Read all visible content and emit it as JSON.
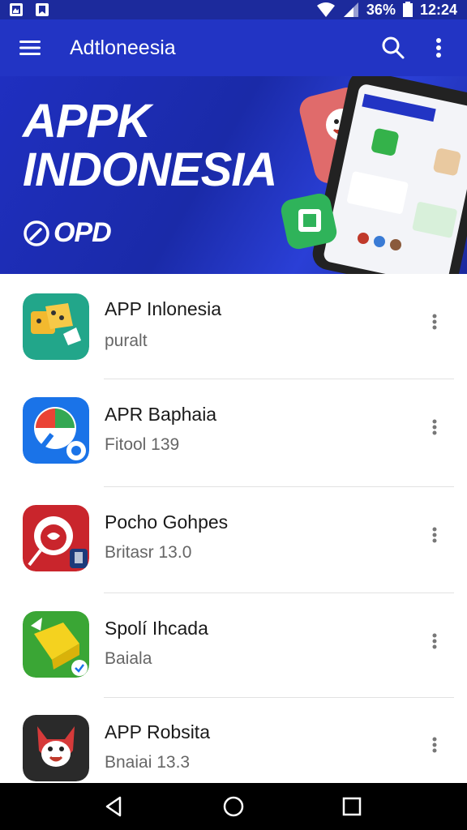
{
  "status_bar": {
    "battery": "36%",
    "time": "12:24"
  },
  "app_bar": {
    "title": "Adtloneesia"
  },
  "banner": {
    "headline_line1": "APPK",
    "headline_line2": "INDONESIA",
    "brand": "OPD"
  },
  "apps": [
    {
      "name": "APP Inlonesia",
      "subtitle": "puralt",
      "icon": "dice-icon",
      "icon_color": "#22a68a"
    },
    {
      "name": "APR Baphaia",
      "subtitle": "Fitool 139",
      "icon": "compass-chat-icon",
      "icon_color": "#1a73e8"
    },
    {
      "name": "Pocho Gohpes",
      "subtitle": "Britasr 13.0",
      "icon": "red-mascot-icon",
      "icon_color": "#c9252c"
    },
    {
      "name": "Spolí Ihcada",
      "subtitle": "Baiala",
      "icon": "yellow-cube-icon",
      "icon_color": "#3aa635"
    },
    {
      "name": "APP Robsita",
      "subtitle": "Bnaiai 13.3",
      "icon": "fox-mascot-icon",
      "icon_color": "#2a2a2a"
    }
  ],
  "colors": {
    "app_bar": "#2234c4",
    "status_bar": "#1c2a9c",
    "banner": "#1f2fc0"
  }
}
